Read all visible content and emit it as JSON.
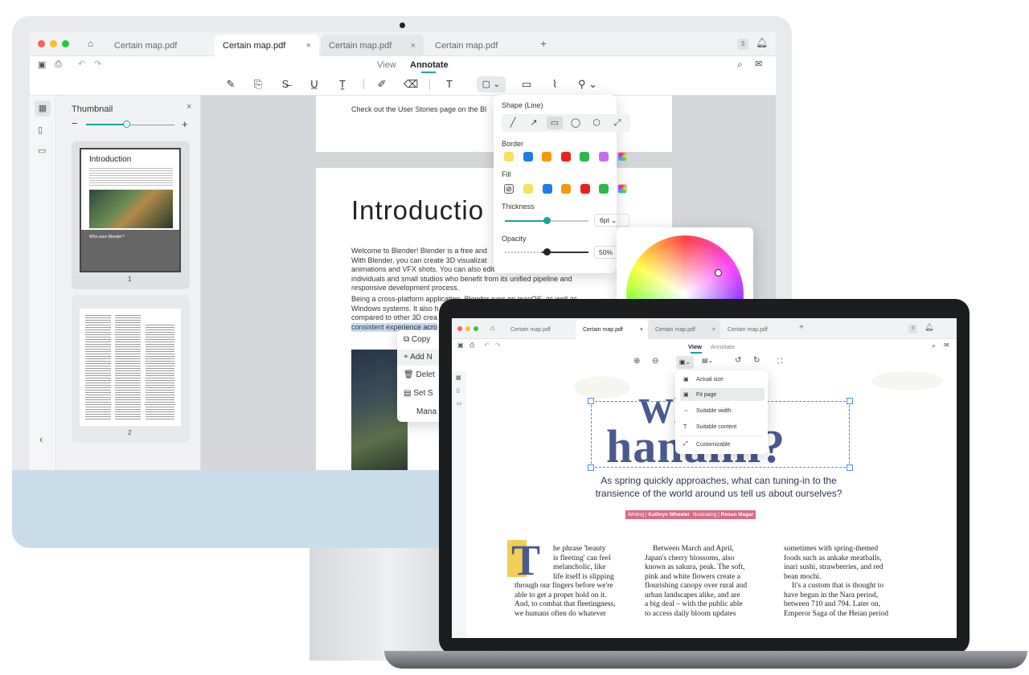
{
  "desktop": {
    "tabs": [
      {
        "label": "Certain map.pdf"
      },
      {
        "label": "Certain map.pdf",
        "active": true
      },
      {
        "label": "Certain map.pdf"
      },
      {
        "label": "Certain map.pdf"
      }
    ],
    "tab_count": "3",
    "modes": {
      "view": "View",
      "annotate": "Annotate"
    },
    "thumbnail_panel": {
      "title": "Thumbnail",
      "page1_label": "1",
      "page2_label": "2",
      "page1_heading": "Introduction",
      "page1_subheading": "Who uses Blender?"
    },
    "page_top_text": "Check out the User Stories page on the Bl",
    "page_heading": "Introductio",
    "paragraph1": [
      "Welcome to Blender! Blender is a free and",
      "With Blender, you can create 3D visualizat",
      "animations and VFX shots. You can also edit videos. It is well suited to",
      "individuals and small studios who benefit from its unified pipeline and",
      "responsive development process."
    ],
    "paragraph2": [
      "Being a cross-platform application, Blender runs on macOS, as well as",
      "Windows systems. It also h",
      "compared to other 3D crea",
      "consistent experience acro"
    ],
    "context_menu": [
      "Copy",
      "Add N",
      "Delet",
      "Set S",
      "Mana"
    ],
    "shape_popover": {
      "shape_title": "Shape (Line)",
      "border_title": "Border",
      "fill_title": "Fill",
      "thickness_title": "Thickness",
      "thickness_value": "6pt",
      "opacity_title": "Opacity",
      "opacity_value": "50%",
      "border_colors": [
        "#f7e15a",
        "#1f7de6",
        "#f29a0c",
        "#e8231d",
        "#2db84a",
        "#c66ef0"
      ],
      "fill_colors": [
        "#f7e15a",
        "#1f7de6",
        "#f29a0c",
        "#e8231d",
        "#2db84a"
      ]
    }
  },
  "laptop": {
    "tabs": [
      {
        "label": "Certain map.pdf"
      },
      {
        "label": "Certain map.pdf",
        "active": true
      },
      {
        "label": "Certain map.pdf"
      },
      {
        "label": "Certain map.pdf"
      }
    ],
    "tab_count": "3",
    "modes": {
      "view": "View",
      "annotate": "Annotate"
    },
    "fit_menu": [
      "Actual size",
      "Fit page",
      "Suitable width",
      "Suitable content",
      "Customizable"
    ],
    "headline": [
      "Wh",
      "hanami?"
    ],
    "subtitle": [
      "As spring quickly approaches, what can tuning-in to the",
      "transience of the world around us tell us about ourselves?"
    ],
    "byline": {
      "writing_label": "Writing |",
      "writer": "Kathryn Wheeler",
      "illustrating_label": "Illustrating |",
      "illustrator": "Rosan Magar"
    },
    "drop_cap": "T",
    "col1": [
      "he phrase 'beauty",
      "is fleeting' can feel",
      "melancholic, like",
      "life itself is slipping",
      "through our fingers before we're",
      "able to get a proper hold on it.",
      "And, to combat that fleetingness,",
      "we humans often do whatever"
    ],
    "col2": [
      "Between March and April,",
      "Japan's cherry blossoms, also",
      "known as sakura, peak. The soft,",
      "pink and white flowers create a",
      "flourishing canopy over rural and",
      "urban landscapes alike, and are",
      "a big deal – with the public able",
      "to access daily bloom updates"
    ],
    "col3": [
      "sometimes with spring-themed",
      "foods such as ankake meatballs,",
      "inari sushi, strawberries, and red",
      "bean mochi.",
      "It's a custom that is thought to",
      "have begun in the Nara period,",
      "between 710 and 794. Later on,",
      "Emperor Saga of the Heian period"
    ]
  },
  "colors": {
    "accent": "#1aa39b",
    "highlight": "#c6dcf5",
    "byline_bg": "#d96a86",
    "dropcap_bg": "#f1cf55",
    "headline": "#4a5a8f"
  }
}
